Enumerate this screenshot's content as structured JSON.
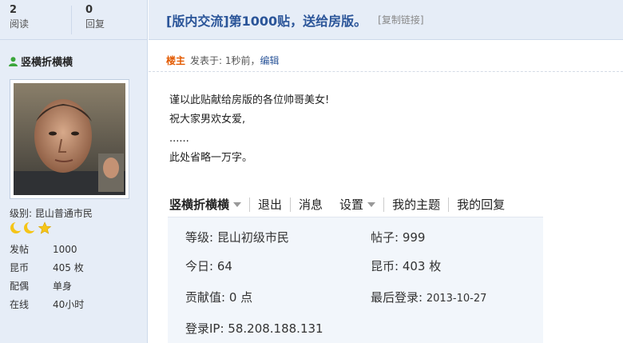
{
  "stats": {
    "views_count": "2",
    "views_label": "阅读",
    "replies_count": "0",
    "replies_label": "回复"
  },
  "thread": {
    "title": "[版内交流]第1000贴，送给房版。",
    "copy_link": "[复制链接]"
  },
  "author": {
    "name": "竖横折横横",
    "level": "级别: 昆山普通市民",
    "info": [
      {
        "key": "发帖",
        "value": "1000"
      },
      {
        "key": "昆币",
        "value": "405 枚"
      },
      {
        "key": "配偶",
        "value": "单身"
      },
      {
        "key": "在线",
        "value": "40小时"
      }
    ]
  },
  "post": {
    "owner_label": "楼主",
    "posted": "发表于: 1秒前，",
    "edit_label": "编辑",
    "lines": [
      "谨以此贴献给房版的各位帅哥美女!",
      "祝大家男欢女爱,",
      "......",
      "此处省略一万字。"
    ]
  },
  "embedded": {
    "username": "竖横折横横",
    "menu": [
      "退出",
      "消息",
      "设置",
      "我的主题",
      "我的回复"
    ],
    "fields": {
      "level": "等级: 昆山初级市民",
      "posts": "帖子: 999",
      "today": "今日: 64",
      "coins": "昆币: 403 枚",
      "contribution": "贡献值: 0 点",
      "last_login_label": "最后登录:",
      "last_login_date": "2013-10-27",
      "login_ip": "登录IP: 58.208.188.131"
    }
  },
  "colors": {
    "sidebar_bg": "#e6edf7",
    "title_blue": "#2b5599",
    "owner_orange": "#e35a00"
  }
}
